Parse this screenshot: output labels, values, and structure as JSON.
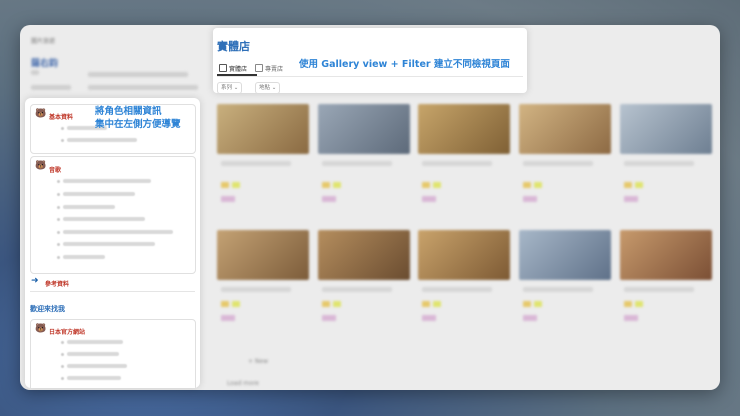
{
  "breadcrumb": "圖片旅遊",
  "sidebar": {
    "title": "薩右鈞",
    "basic": {
      "header": "基本資料"
    },
    "music": {
      "header": "音歌"
    },
    "ref_link": "參考資料",
    "welcome_title": "歡迎來找我",
    "official": {
      "header": "日本官方網站"
    }
  },
  "annotations": {
    "left_line1": "將角色相關資訊",
    "left_line2": "集中在左側方便導覽",
    "top": "使用 Gallery view + Filter 建立不同檢視頁面"
  },
  "page": {
    "title": "實體店",
    "tabs": [
      {
        "label": "實體店"
      },
      {
        "label": "專賣店"
      }
    ],
    "filters": [
      {
        "label": "系列"
      },
      {
        "label": "地點"
      }
    ]
  },
  "gallery": {
    "new_label": "+ New",
    "load_more": "Load more"
  },
  "colors": {
    "accent_blue": "#2e84d6",
    "header_red": "#c0392b",
    "bear": "#b07a2a"
  },
  "icons": [
    "bear-icon",
    "arrow-right-icon",
    "gallery-icon",
    "chevron-down-icon"
  ]
}
